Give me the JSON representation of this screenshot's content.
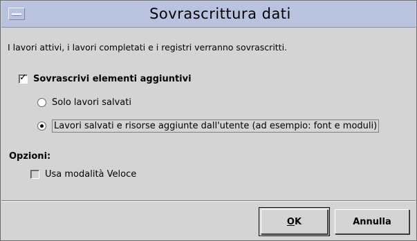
{
  "dialog": {
    "title": "Sovrascrittura dati",
    "description": "I lavori attivi, i lavori completati e i registri verranno sovrascritti."
  },
  "overwrite_extra": {
    "label": "Sovrascrivi elementi aggiuntivi",
    "checked": true
  },
  "radio_options": [
    {
      "label": "Solo lavori salvati",
      "selected": false
    },
    {
      "label": "Lavori salvati e risorse aggiunte dall'utente (ad esempio: font e moduli)",
      "selected": true
    }
  ],
  "options": {
    "heading": "Opzioni:",
    "fast_mode_label": "Usa modalità Veloce",
    "fast_mode_checked": false
  },
  "buttons": {
    "ok_mnemonic": "O",
    "ok_rest": "K",
    "cancel_label": "Annulla"
  }
}
